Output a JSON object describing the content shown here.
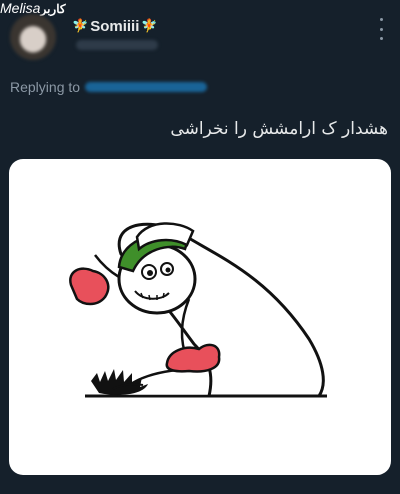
{
  "watermark": {
    "latin": "Melisa",
    "persian": "کاربر"
  },
  "tweet": {
    "display_name": "Somiiii",
    "sparkle_left": "🧚",
    "sparkle_right": "🧚",
    "replying_label": "Replying to",
    "text": "هشدار ک ارامشش را نخراشی"
  },
  "media": {
    "description_icon": "meme-cartoon-image"
  },
  "colors": {
    "background": "#15202b",
    "muted": "#8b98a5",
    "link": "#1d9bf0",
    "glove_red": "#e8505b",
    "hat_green": "#3f8f2a"
  }
}
